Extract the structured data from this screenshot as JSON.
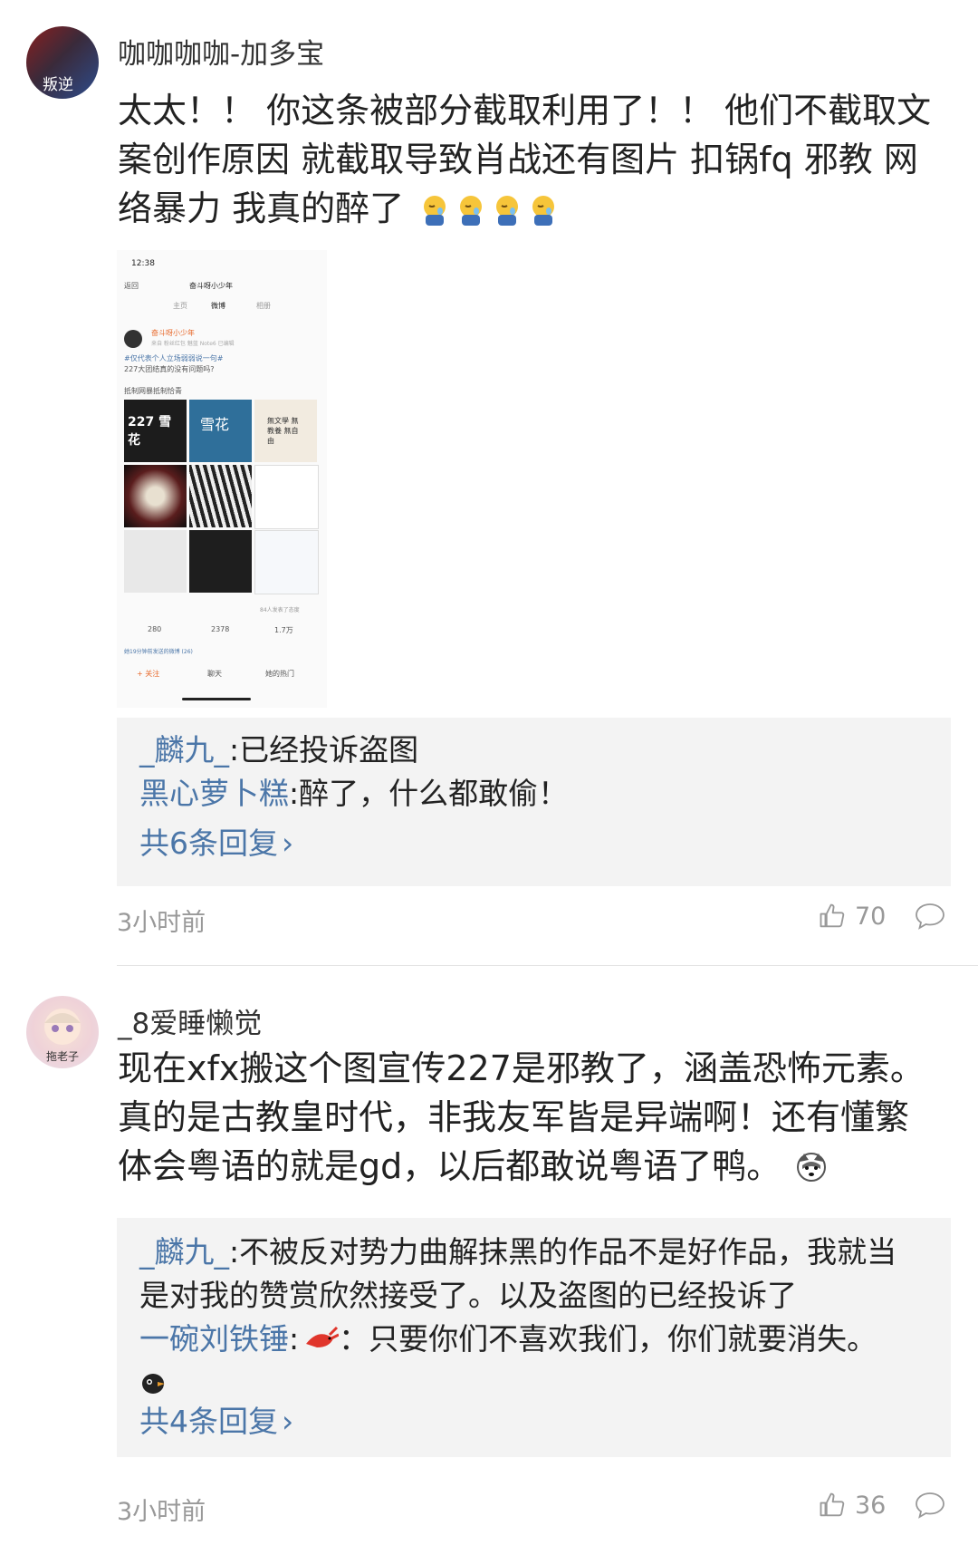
{
  "comments": [
    {
      "username": "咖咖咖咖-加多宝",
      "avatar_label": "叛逆",
      "content_line1": "太太！！ 你这条被部分截取利用了！！ 他们不截取文",
      "content_line2": "案创作原因 就截取导致肖战还有图片 扣锅fq 邪教 网",
      "content_line3": "络暴力 我真的醉了",
      "emojis": [
        "sleepy-face-emoji",
        "sleepy-face-emoji",
        "sleepy-face-emoji",
        "sleepy-face-emoji"
      ],
      "embedded_screenshot": {
        "status_time": "12:38",
        "back": "返回",
        "page_title": "奋斗呀小少年",
        "tabs": [
          "主页",
          "微博",
          "相册"
        ],
        "post_author": "奋斗呀小少年",
        "post_meta": "来自 粉丝红包 魅蓝 Note6  已编辑",
        "post_text1": "#仅代表个人立场弱弱说一句#",
        "post_text2": "227大团结真的没有问题吗?",
        "post_text3": "抵制网暴抵制恰青",
        "tile_text_1": "227 雪花",
        "tile_text_2": "雪花",
        "tile_text_3": "無文學 無教養 無自由",
        "reposts_line": "84人发表了态度",
        "count_repost": "280",
        "count_comment": "2378",
        "count_like": "1.7万",
        "recent_bar": "她19分钟前发送的微博 (26)",
        "bottom_follow": "+ 关注",
        "bottom_chat": "聊天",
        "bottom_hot": "她的热门"
      },
      "replies": [
        {
          "name": "_麟九_",
          "sep": ":",
          "text": "已经投诉盗图"
        },
        {
          "name": "黑心萝卜糕",
          "sep": ":",
          "text": "醉了，什么都敢偷！"
        }
      ],
      "more_replies": "共6条回复",
      "time": "3小时前",
      "likes": "70"
    },
    {
      "username": "_8爱睡懒觉",
      "avatar_label": "拖老子",
      "content_line1": "现在xfx搬这个图宣传227是邪教了，涵盖恐怖元素。",
      "content_line2": "真的是古教皇时代，非我友军皆是异端啊！还有懂繁",
      "content_line3": "体会粤语的就是gd，以后都敢说粤语了鸭。",
      "replies": [
        {
          "name": "_麟九_",
          "sep": ":",
          "text": "不被反对势力曲解抹黑的作品不是好作品，我就当",
          "text2": "是对我的赞赏欣然接受了。以及盗图的已经投诉了"
        },
        {
          "name": "一碗刘铁锤",
          "sep": ":",
          "text": "：只要你们不喜欢我们，你们就要消失。"
        }
      ],
      "more_replies": "共4条回复",
      "time": "3小时前",
      "likes": "36"
    }
  ],
  "colors": {
    "link": "#4b76a8",
    "meta": "#999999",
    "reply_bg": "#f3f3f3"
  },
  "chevron": "›"
}
